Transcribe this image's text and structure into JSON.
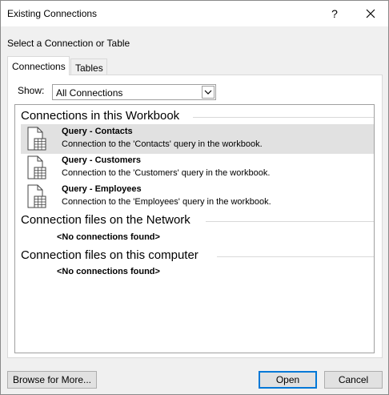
{
  "window": {
    "title": "Existing Connections",
    "help": "?",
    "close": "✕"
  },
  "subtitle": "Select a Connection or Table",
  "tabs": [
    {
      "label": "Connections",
      "active": true
    },
    {
      "label": "Tables",
      "active": false
    }
  ],
  "show": {
    "label": "Show:",
    "value": "All Connections"
  },
  "groups": {
    "workbook": {
      "header": "Connections in this Workbook",
      "items": [
        {
          "name": "Query - Contacts",
          "desc": "Connection to the 'Contacts' query in the workbook.",
          "selected": true
        },
        {
          "name": "Query - Customers",
          "desc": "Connection to the 'Customers' query in the workbook.",
          "selected": false
        },
        {
          "name": "Query - Employees",
          "desc": "Connection to the 'Employees' query in the workbook.",
          "selected": false
        }
      ]
    },
    "network": {
      "header": "Connection files on the Network",
      "empty": "<No connections found>"
    },
    "computer": {
      "header": "Connection files on this computer",
      "empty": "<No connections found>"
    }
  },
  "buttons": {
    "browse": "Browse for More...",
    "open": "Open",
    "cancel": "Cancel"
  },
  "colors": {
    "selection": "#e1e1e1",
    "accent": "#0078d7"
  }
}
